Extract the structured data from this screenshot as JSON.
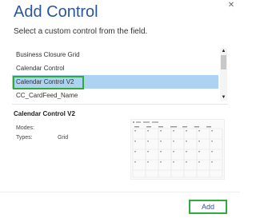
{
  "dialog": {
    "title": "Add Control",
    "subtitle": "Select a custom control from the field.",
    "close_glyph": "✕"
  },
  "list": {
    "items": [
      {
        "label": "Business Closure Grid",
        "selected": false
      },
      {
        "label": "Calendar Control",
        "selected": false
      },
      {
        "label": "Calendar Control V2",
        "selected": true
      },
      {
        "label": "CC_CardFeed_Name",
        "selected": false
      }
    ],
    "scroll_up_glyph": "▲",
    "scroll_down_glyph": "▼"
  },
  "details": {
    "title": "Calendar Control V2",
    "modes_label": "Modes:",
    "modes_value": "",
    "types_label": "Types:",
    "types_value": "Grid"
  },
  "preview": {
    "icon": "calendar-preview-thumbnail"
  },
  "footer": {
    "add_label": "Add"
  },
  "colors": {
    "accent": "#2b579a",
    "selection": "#aed2f2",
    "highlight_outline": "#2eab3b"
  }
}
